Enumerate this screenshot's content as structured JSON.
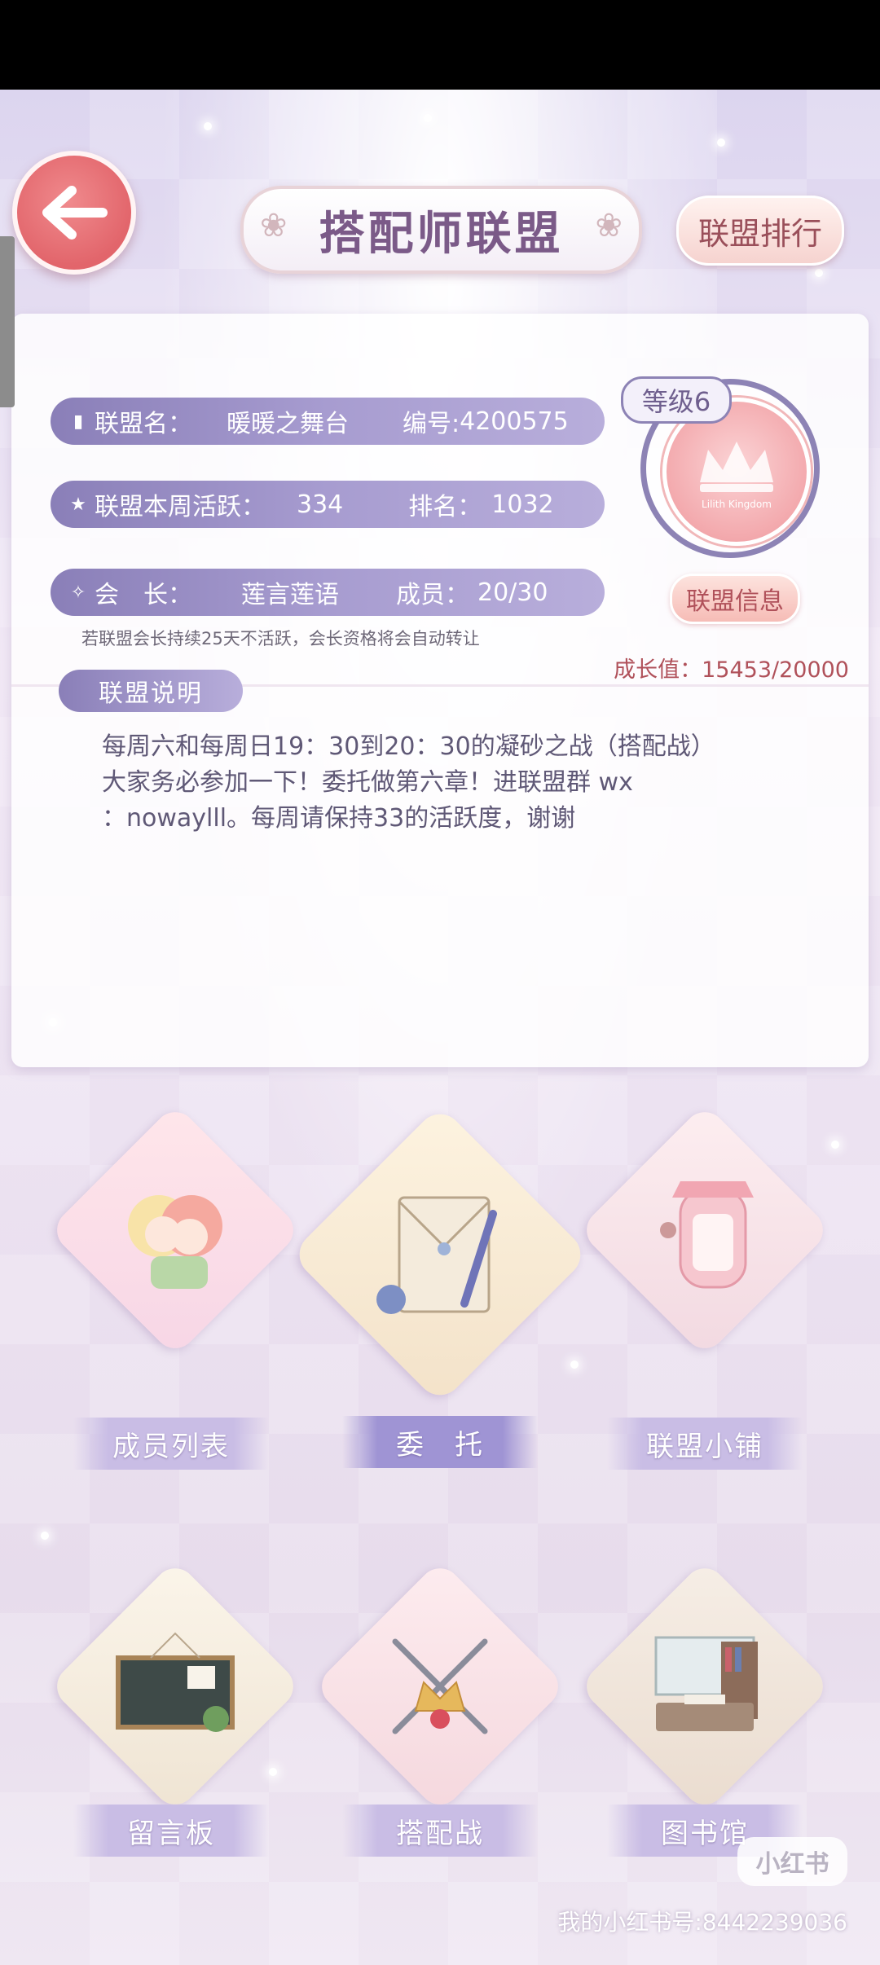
{
  "header": {
    "title": "搭配师联盟",
    "rank_button": "联盟排行"
  },
  "guild": {
    "name_label": "联盟名：",
    "name": "暖暖之舞台",
    "id_label": "编号:",
    "id": "4200575",
    "weekly_active_label": "联盟本周活跃：",
    "weekly_active": "334",
    "rank_label": "排名：",
    "rank": "1032",
    "leader_label": "会　长：",
    "leader": "莲言莲语",
    "members_label": "成员：",
    "members": "20/30",
    "level": "等级6",
    "emblem_text": "Lilith Kingdom",
    "info_button": "联盟信息",
    "notice": "若联盟会长持续25天不活跃，会长资格将会自动转让",
    "growth": "成长值：15453/20000"
  },
  "description": {
    "tag": "联盟说明",
    "line1": "每周六和每周日19：30到20：30的凝砂之战（搭配战）",
    "line2": "大家务必参加一下！委托做第六章！进联盟群 wx",
    "line3": "：nowaylll。每周请保持33的活跃度，谢谢"
  },
  "features": [
    {
      "label": "成员列表",
      "icon": "members-icon"
    },
    {
      "label": "委　托",
      "icon": "commission-icon"
    },
    {
      "label": "联盟小铺",
      "icon": "shop-icon"
    },
    {
      "label": "留言板",
      "icon": "message-board-icon"
    },
    {
      "label": "搭配战",
      "icon": "battle-icon"
    },
    {
      "label": "图书馆",
      "icon": "library-icon"
    }
  ],
  "watermark": {
    "logo": "小红书",
    "text": "我的小红书号:8442239036"
  },
  "colors": {
    "accent_purple": "#8a7fb8",
    "accent_pink": "#e2656b",
    "title_text": "#7b5a88"
  }
}
